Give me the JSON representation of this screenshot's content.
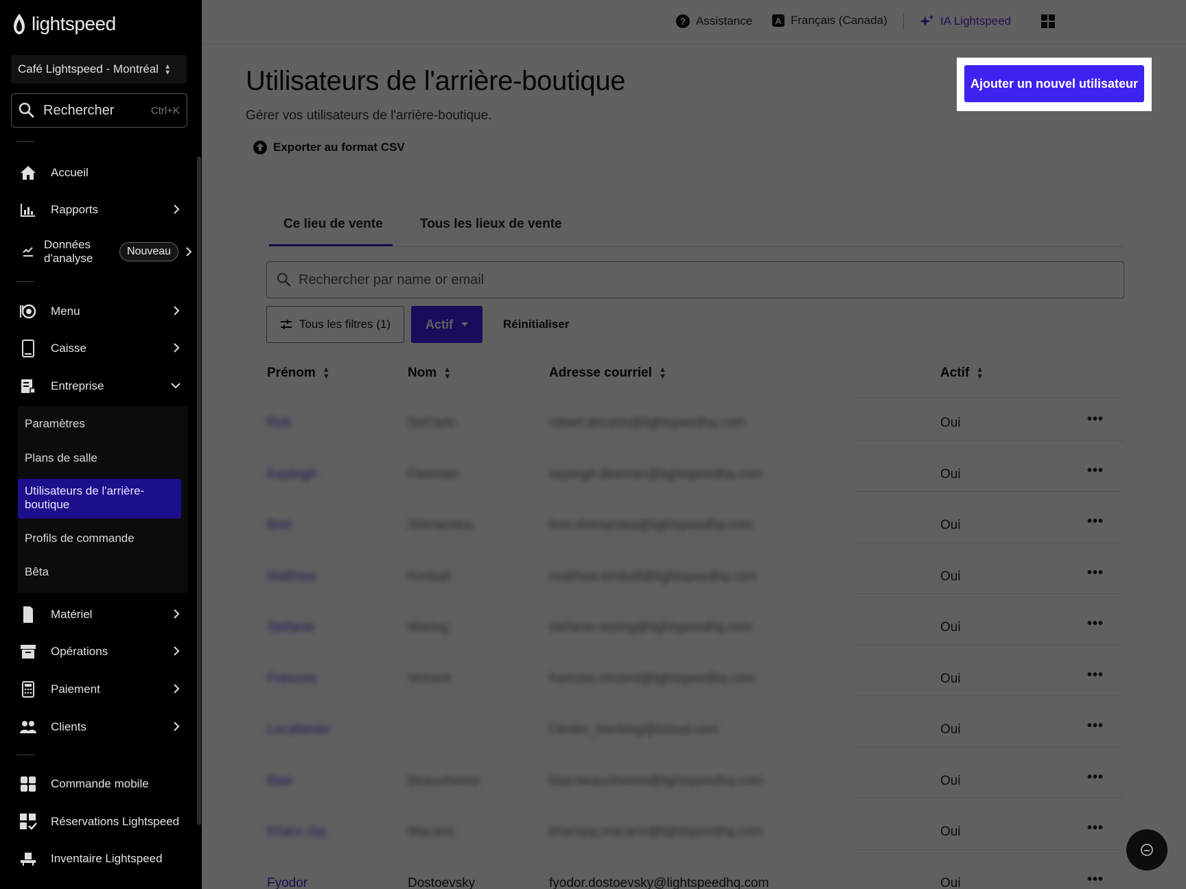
{
  "brand": {
    "name": "lightspeed"
  },
  "sidebar": {
    "store": "Café Lightspeed - Montréal",
    "search": {
      "label": "Rechercher",
      "shortcut": "Ctrl+K"
    },
    "items": [
      {
        "label": "Accueil"
      },
      {
        "label": "Rapports"
      },
      {
        "label": "Données d'analyse",
        "badge": "Nouveau"
      },
      {
        "label": "Menu"
      },
      {
        "label": "Caisse"
      },
      {
        "label": "Entreprise"
      },
      {
        "label": "Matériel"
      },
      {
        "label": "Opérations"
      },
      {
        "label": "Paiement"
      },
      {
        "label": "Clients"
      },
      {
        "label": "Commande mobile"
      },
      {
        "label": "Réservations Lightspeed"
      },
      {
        "label": "Inventaire Lightspeed"
      }
    ],
    "entreprise_sub": [
      {
        "label": "Paramètres"
      },
      {
        "label": "Plans de salle"
      },
      {
        "label": "Utilisateurs de l'arrière-boutique",
        "active": true
      },
      {
        "label": "Profils de commande"
      },
      {
        "label": "Bêta"
      }
    ]
  },
  "topbar": {
    "help": "Assistance",
    "language": "Français (Canada)",
    "ai": "IA Lightspeed"
  },
  "page": {
    "title": "Utilisateurs de l'arrière-boutique",
    "subtitle": "Gérer vos utilisateurs de l'arrière-boutique.",
    "export_label": "Exporter au format CSV",
    "add_button": "Ajouter un nouvel utilisateur"
  },
  "tabs": [
    {
      "label": "Ce lieu de vente",
      "active": true
    },
    {
      "label": "Tous les lieux de vente"
    }
  ],
  "filters": {
    "search_placeholder": "Rechercher par name or email",
    "all_filters": "Tous les filtres (1)",
    "status": "Actif",
    "reset": "Réinitialiser"
  },
  "table": {
    "columns": [
      "Prénom",
      "Nom",
      "Adresse courriel",
      "Actif"
    ],
    "rows": [
      {
        "first": "Rob",
        "last": "DeCarlo",
        "email": "robert.decarlo@lightspeedhq.com",
        "active": "Oui",
        "blurred": true
      },
      {
        "first": "Kayleigh",
        "last": "Fleeman",
        "email": "kayleigh.fleeman@lightspeedhq.com",
        "active": "Oui",
        "blurred": true
      },
      {
        "first": "Bret",
        "last": "Shimanska",
        "email": "bret.shimanska@lightspeedhq.com",
        "active": "Oui",
        "blurred": true
      },
      {
        "first": "Matthew",
        "last": "Kimball",
        "email": "matthew.kimball@lightspeedhq.com",
        "active": "Oui",
        "blurred": true
      },
      {
        "first": "Stefanie",
        "last": "Waring",
        "email": "stefanie.waring@lightspeedhq.com",
        "active": "Oui",
        "blurred": true
      },
      {
        "first": "Francois",
        "last": "Vincent",
        "email": "francois.vincent@lightspeedhq.com",
        "active": "Oui",
        "blurred": true
      },
      {
        "first": "Localtester",
        "last": "",
        "email": "f.tester_lswrking@icloud.com",
        "active": "Oui",
        "blurred": true
      },
      {
        "first": "Blair",
        "last": "Beauchesne",
        "email": "blair.beauchesne@lightspeedhq.com",
        "active": "Oui",
        "blurred": true
      },
      {
        "first": "Kharn-Jay",
        "last": "Macario",
        "email": "kharnjay.macario@lightspeedhq.com",
        "active": "Oui",
        "blurred": true
      },
      {
        "first": "Fyodor",
        "last": "Dostoevsky",
        "email": "fyodor.dostoevsky@lightspeedhq.com",
        "active": "Oui",
        "blurred": false
      }
    ]
  },
  "colors": {
    "accent": "#3d22f0",
    "active_nav": "#1c0f8c",
    "link": "#3d2fd6"
  }
}
